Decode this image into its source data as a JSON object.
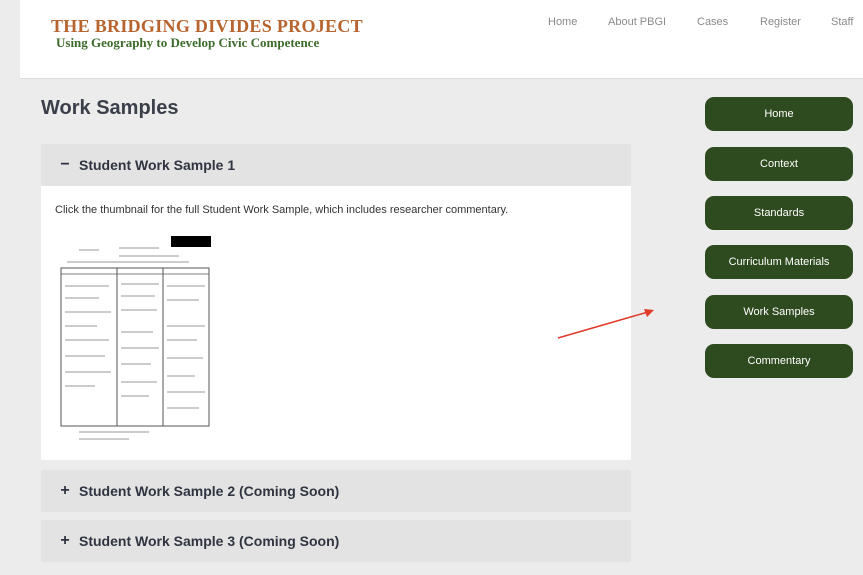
{
  "header": {
    "title": "THE BRIDGING DIVIDES PROJECT",
    "subtitle": "Using Geography to Develop Civic Competence",
    "nav": [
      "Home",
      "About PBGI",
      "Cases",
      "Register",
      "Staff"
    ]
  },
  "page": {
    "title": "Work Samples"
  },
  "accordion": {
    "items": [
      {
        "sign": "−",
        "label": "Student Work Sample 1",
        "expanded": true
      },
      {
        "sign": "+",
        "label": "Student Work Sample 2 (Coming Soon)",
        "expanded": false
      },
      {
        "sign": "+",
        "label": "Student Work Sample 3 (Coming Soon)",
        "expanded": false
      }
    ],
    "body_text": "Click the thumbnail for the full Student Work Sample, which includes researcher commentary."
  },
  "sidebar": {
    "buttons": [
      "Home",
      "Context",
      "Standards",
      "Curriculum Materials",
      "Work Samples",
      "Commentary"
    ]
  },
  "colors": {
    "button_bg": "#2e4a1f",
    "title_orange": "#b7642f",
    "subtitle_green": "#3c6b2b",
    "arrow_red": "#e03a2a"
  }
}
